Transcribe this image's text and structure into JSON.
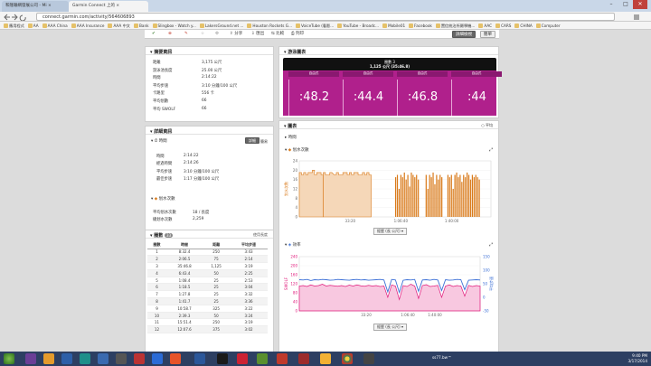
{
  "browser": {
    "tabs": [
      {
        "label": "和隆聯網發展公司 - Mi ×"
      },
      {
        "label": "Garmin Connect 上的 ×"
      }
    ],
    "window_controls": {
      "min": "–",
      "max": "□",
      "close": "✕"
    },
    "url": "connect.garmin.com/activity/564606893",
    "bookmarks": [
      "應用程式",
      "AA",
      "AAA China",
      "AAA Insurance",
      "AAA 中文",
      "Bank",
      "Slingbox - Watch y...",
      "LakersGround.net ...",
      "Houston Rockets G...",
      "VoiceTube (看影...",
      "YouTube - Broadc...",
      "Mobile01",
      "Facebook",
      "置信統治所屬學機...",
      "AAC",
      "CARS",
      "CHINA",
      "Computer"
    ]
  },
  "toolbar": {
    "share": "分享",
    "export": "匯出",
    "compare": "比較",
    "print": "列印",
    "view_detail": "詳細檢視",
    "view_simple": "簡單"
  },
  "summary": {
    "title": "摘要資訊",
    "rows": [
      {
        "label": "距離",
        "value": "3,175 公尺"
      },
      {
        "label": "游泳池長度",
        "value": "25.00 公尺"
      },
      {
        "label": "時間",
        "value": "2:14:22"
      },
      {
        "label": "平均步速",
        "value": "3:10 分鐘/100 公尺"
      },
      {
        "label": "卡路里",
        "value": "556 卡"
      },
      {
        "label": "平均划數",
        "value": "66"
      },
      {
        "label": "平均 SWOLF",
        "value": "66"
      }
    ]
  },
  "details": {
    "title": "詳細資訊",
    "time_section": "時間",
    "detail_btn": "詳細",
    "simple_btn": "簡易",
    "time_rows": [
      {
        "label": "時間",
        "value": "2:14:22"
      },
      {
        "label": "經過時間",
        "value": "2:14:26"
      },
      {
        "label": "平均步速",
        "value": "3:10 分鐘/100 公尺"
      },
      {
        "label": "最佳步速",
        "value": "1:17 分鐘/100 公尺"
      }
    ],
    "strokes_section": "划水次數",
    "stroke_rows": [
      {
        "label": "平均划水次數",
        "value": "18 / 長度"
      },
      {
        "label": "總划水次數",
        "value": "2,259"
      }
    ]
  },
  "laps": {
    "title": "圈數",
    "count": "33",
    "link": "使用長度",
    "headers": [
      "圈數",
      "時間",
      "距離",
      "平均步速"
    ],
    "rows": [
      [
        "1",
        "8:32.4",
        "250",
        "3:43"
      ],
      [
        "2",
        "2:06.5",
        "75",
        "2:14"
      ],
      [
        "3",
        "35:46.8",
        "1,125",
        "3:19"
      ],
      [
        "4",
        "6:43.4",
        "50",
        "2:25"
      ],
      [
        "5",
        "1:08.4",
        "25",
        "2:53"
      ],
      [
        "6",
        "1:18.5",
        "25",
        "3:04"
      ],
      [
        "7",
        "1:27.8",
        "25",
        "3:32"
      ],
      [
        "8",
        "1:41.7",
        "25",
        "3:36"
      ],
      [
        "9",
        "10:58.7",
        "325",
        "3:22"
      ],
      [
        "10",
        "2:39.3",
        "50",
        "3:24"
      ],
      [
        "11",
        "15:51.4",
        "250",
        "3:19"
      ],
      [
        "12",
        "12:07.6",
        "375",
        "3:02"
      ]
    ]
  },
  "swim_chart": {
    "title": "游泳圖表",
    "tooltip_title": "圈數 3",
    "tooltip_sub": "1,125 公尺 (35:46.8)",
    "lengths": [
      {
        "label": "自由式",
        "value": ":48.2"
      },
      {
        "label": "自由式",
        "value": ":44.4"
      },
      {
        "label": "自由式",
        "value": ":46.8"
      },
      {
        "label": "自由式",
        "value": ":44"
      }
    ]
  },
  "charts": {
    "title": "圖表",
    "toggle": "平均",
    "time_section": "時間",
    "strokes_section": "划水次數",
    "efficiency_section": "效率",
    "xaxis_select": "經歷 (長 公尺)",
    "colors": {
      "strokes": "#d97a1a",
      "strokes_fill": "#f5d7b8",
      "efficiency_pink": "#e0187a",
      "efficiency_blue": "#3b6fd6"
    }
  },
  "chart_data": [
    {
      "type": "bar",
      "title": "划水次數",
      "ylabel": "划水次數",
      "yticks": [
        "24",
        "20",
        "16",
        "12",
        "8",
        "4",
        "0"
      ],
      "ylim": [
        0,
        24
      ],
      "xticks": [
        "33:20",
        "1:06:40",
        "1:40:00"
      ],
      "segments": [
        {
          "x": [
            0.0,
            0.5,
            1.0,
            1.5,
            2.0,
            2.5,
            3.0,
            3.5,
            4.0,
            4.5,
            5.0
          ],
          "values": [
            19,
            18,
            19,
            18,
            19,
            19,
            20,
            18,
            19,
            19,
            18
          ],
          "fill": true
        },
        {
          "x": [
            5.5,
            6.0,
            6.5,
            7.0,
            8.0,
            8.5,
            9.0,
            9.5,
            10.0,
            10.5,
            11.0,
            11.5,
            12.0,
            12.5,
            13.0,
            13.5,
            14.0,
            14.5,
            15.0,
            15.5,
            16.0
          ],
          "values": [
            19,
            18,
            18,
            19,
            18,
            19,
            18,
            18,
            19,
            19,
            18,
            19,
            18,
            19,
            19,
            18,
            18,
            19,
            18,
            19,
            18
          ],
          "fill": true
        },
        {
          "x": [
            22.0,
            22.4,
            22.8,
            23.2,
            23.6,
            24.0,
            24.4,
            24.8,
            25.2,
            25.6,
            26.0,
            26.4,
            26.8,
            27.2
          ],
          "values": [
            17,
            18,
            12,
            18,
            17,
            19,
            16,
            18,
            13,
            19,
            18,
            17,
            18,
            16
          ],
          "fill": false
        },
        {
          "x": [
            29.0,
            29.4,
            29.8,
            30.2,
            30.6,
            31.0,
            31.4,
            31.8,
            32.2,
            32.6
          ],
          "values": [
            18,
            12,
            18,
            17,
            19,
            14,
            18,
            16,
            18,
            17
          ],
          "fill": false
        },
        {
          "x": [
            34.0,
            34.4,
            34.8,
            35.2,
            35.6,
            36.0,
            36.4,
            36.8,
            37.2,
            37.6,
            38.0,
            38.4,
            38.8,
            39.2,
            39.6,
            40.0,
            40.4,
            40.8,
            41.2
          ],
          "values": [
            18,
            17,
            18,
            12,
            18,
            19,
            17,
            18,
            15,
            18,
            17,
            19,
            18,
            16,
            18,
            17,
            18,
            17,
            16
          ],
          "fill": false
        }
      ]
    },
    {
      "type": "line",
      "title": "效率",
      "ylabel_left": "SWOLF",
      "ylabel_right": "平均步速",
      "yticks_left": [
        "240",
        "200",
        "160",
        "120",
        "80",
        "40",
        "0"
      ],
      "yticks_right": [
        "150",
        "100",
        "50",
        "0",
        "-50"
      ],
      "xticks": [
        "33:20",
        "1:06:40",
        "1:40:00"
      ],
      "note": "series values estimated from pixels",
      "swolf": [
        110,
        112,
        108,
        115,
        110,
        112,
        118,
        110,
        113,
        111,
        109,
        112,
        108,
        114,
        110,
        115,
        111,
        109,
        113,
        110,
        112,
        108,
        110,
        60,
        115,
        110,
        50,
        112,
        108,
        118,
        110,
        55,
        112,
        116,
        108,
        110,
        113,
        60,
        110,
        115,
        108,
        112,
        110,
        65,
        113,
        108,
        112,
        110
      ],
      "pace": [
        65,
        64,
        66,
        62,
        65,
        64,
        66,
        65,
        63,
        64,
        66,
        65,
        64,
        63,
        65,
        66,
        64,
        65,
        63,
        64,
        65,
        66,
        64,
        20,
        66,
        64,
        18,
        63,
        65,
        64,
        66,
        22,
        64,
        65,
        63,
        66,
        64,
        25,
        65,
        63,
        64,
        66,
        65,
        28,
        63,
        64,
        65,
        64
      ]
    }
  ],
  "taskbar": {
    "time": "9:40 PM",
    "date": "3/17/2014",
    "running": "ss77.bw™"
  }
}
